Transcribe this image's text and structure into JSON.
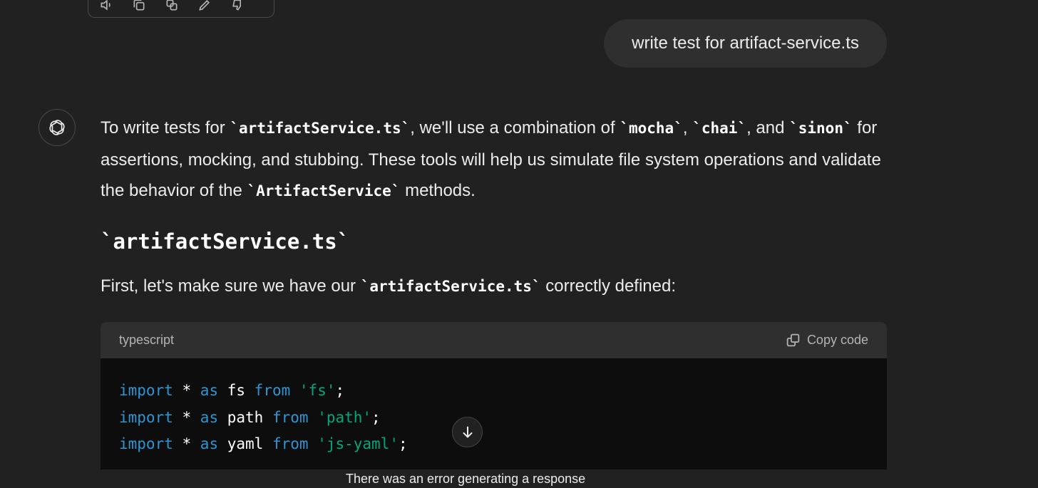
{
  "top_actions": {
    "icons": [
      "speaker-icon",
      "copy-icon",
      "regenerate-icon",
      "edit-icon",
      "thumbs-down-icon"
    ]
  },
  "user_message": {
    "text": "write test for artifact-service.ts"
  },
  "assistant": {
    "avatar_icon": "openai-logo-icon",
    "paragraph": {
      "p1": "To write tests for ",
      "c1": "`artifactService.ts`",
      "p2": ", we'll use a combination of ",
      "c2": "`mocha`",
      "p3": ", ",
      "c3": "`chai`",
      "p4": ", and ",
      "c4": "`sinon`",
      "p5": " for assertions, mocking, and stubbing. These tools will help us simulate file system operations and validate the behavior of the ",
      "c5": "`ArtifactService`",
      "p6": " methods."
    },
    "heading": "`artifactService.ts`",
    "intro": {
      "p1": "First, let's make sure we have our ",
      "c1": "`artifactService.ts`",
      "p2": " correctly defined:"
    },
    "code_block": {
      "language": "typescript",
      "copy_label": "Copy code",
      "lines": [
        {
          "kw1": "import",
          "t1": " * ",
          "kw2": "as",
          "t2": " fs ",
          "kw3": "from",
          "t3": " ",
          "str": "'fs'",
          "t4": ";"
        },
        {
          "kw1": "import",
          "t1": " * ",
          "kw2": "as",
          "t2": " path ",
          "kw3": "from",
          "t3": " ",
          "str": "'path'",
          "t4": ";"
        },
        {
          "kw1": "import",
          "t1": " * ",
          "kw2": "as",
          "t2": " yaml ",
          "kw3": "from",
          "t3": " ",
          "str": "'js-yaml'",
          "t4": ";"
        }
      ]
    }
  },
  "scroll_button_icon": "arrow-down-icon",
  "error_message": "There was an error generating a response",
  "colors": {
    "background": "#212121",
    "bubble": "#2f2f2f",
    "code_bg": "#0d0d0d",
    "keyword": "#2e95d3",
    "string": "#00a67d"
  }
}
